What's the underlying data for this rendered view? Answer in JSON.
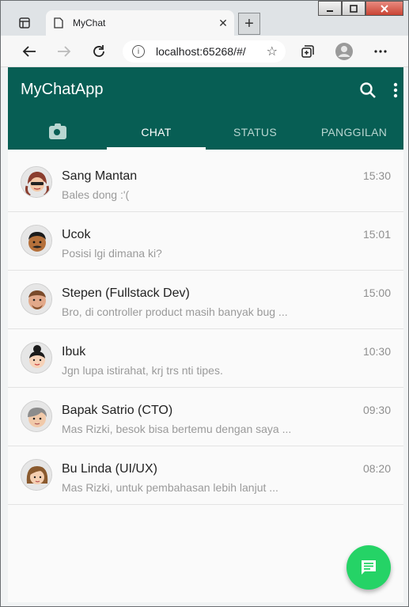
{
  "browser": {
    "tab_title": "MyChat",
    "address": "localhost:65268/#/",
    "new_tab_symbol": "+",
    "tab_close_symbol": "✕"
  },
  "app": {
    "title": "MyChatApp",
    "tabs": [
      {
        "label": "",
        "icon": "camera-icon"
      },
      {
        "label": "CHAT",
        "active": true
      },
      {
        "label": "STATUS"
      },
      {
        "label": "PANGGILAN"
      }
    ],
    "chats": [
      {
        "name": "Sang Mantan",
        "message": "Bales dong :'(",
        "time": "15:30"
      },
      {
        "name": "Ucok",
        "message": "Posisi lgi dimana ki?",
        "time": "15:01"
      },
      {
        "name": "Stepen (Fullstack Dev)",
        "message": "Bro, di controller product masih banyak bug ...",
        "time": "15:00"
      },
      {
        "name": "Ibuk",
        "message": "Jgn lupa istirahat, krj trs nti tipes.",
        "time": "10:30"
      },
      {
        "name": "Bapak Satrio (CTO)",
        "message": "Mas Rizki, besok bisa bertemu dengan saya ...",
        "time": "09:30"
      },
      {
        "name": "Bu Linda (UI/UX)",
        "message": "Mas Rizki, untuk pembahasan lebih lanjut ...",
        "time": "08:20"
      }
    ]
  },
  "colors": {
    "primary": "#075e54",
    "fab": "#25d366"
  }
}
